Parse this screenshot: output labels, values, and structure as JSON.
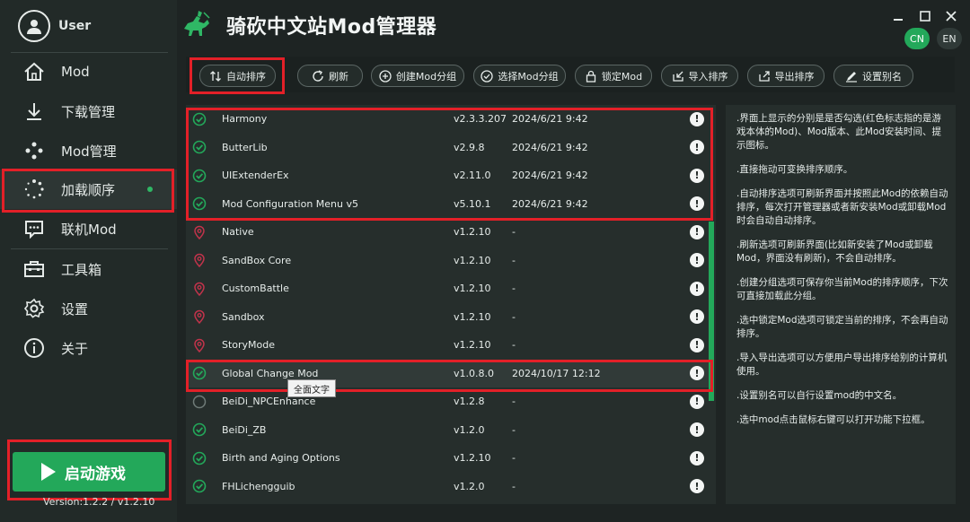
{
  "user": {
    "name": "User"
  },
  "sidebar": {
    "items": [
      {
        "label": "Mod",
        "icon": "home-icon"
      },
      {
        "label": "下载管理",
        "icon": "download-icon"
      },
      {
        "label": "Mod管理",
        "icon": "dots-icon"
      },
      {
        "label": "加载顺序",
        "icon": "loading-icon",
        "active": true
      },
      {
        "label": "联机Mod",
        "icon": "chat-icon"
      },
      {
        "label": "工具箱",
        "icon": "toolbox-icon"
      },
      {
        "label": "设置",
        "icon": "gear-icon"
      },
      {
        "label": "关于",
        "icon": "info-icon"
      }
    ]
  },
  "launch": {
    "label": "启动游戏"
  },
  "version": "Version:1.2.2 / v1.2.10",
  "app": {
    "title": "骑砍中文站Mod管理器"
  },
  "lang": {
    "cn": "CN",
    "en": "EN"
  },
  "toolbar": {
    "auto_sort": "自动排序",
    "refresh": "刷新",
    "create_group": "创建Mod分组",
    "select_group": "选择Mod分组",
    "lock_mod": "锁定Mod",
    "import_sort": "导入排序",
    "export_sort": "导出排序",
    "set_alias": "设置别名"
  },
  "mods": [
    {
      "name": "Harmony",
      "version": "v2.3.3.207",
      "date": "2024/6/21 9:42",
      "status": "enabled"
    },
    {
      "name": "ButterLib",
      "version": "v2.9.8",
      "date": "2024/6/21 9:42",
      "status": "enabled"
    },
    {
      "name": "UIExtenderEx",
      "version": "v2.11.0",
      "date": "2024/6/21 9:42",
      "status": "enabled"
    },
    {
      "name": "Mod Configuration Menu v5",
      "version": "v5.10.1",
      "date": "2024/6/21 9:42",
      "status": "enabled"
    },
    {
      "name": "Native",
      "version": "v1.2.10",
      "date": "-",
      "status": "official"
    },
    {
      "name": "SandBox Core",
      "version": "v1.2.10",
      "date": "-",
      "status": "official"
    },
    {
      "name": "CustomBattle",
      "version": "v1.2.10",
      "date": "-",
      "status": "official"
    },
    {
      "name": "Sandbox",
      "version": "v1.2.10",
      "date": "-",
      "status": "official"
    },
    {
      "name": "StoryMode",
      "version": "v1.2.10",
      "date": "-",
      "status": "official"
    },
    {
      "name": "Global Change Mod",
      "version": "v1.0.8.0",
      "date": "2024/10/17 12:12",
      "status": "enabled"
    },
    {
      "name": "BeiDi_NPCEnhance",
      "version": "v1.2.8",
      "date": "-",
      "status": "disabled"
    },
    {
      "name": "BeiDi_ZB",
      "version": "v1.2.0",
      "date": "-",
      "status": "enabled"
    },
    {
      "name": "Birth and Aging Options",
      "version": "v1.2.10",
      "date": "-",
      "status": "enabled"
    },
    {
      "name": "FHLichengguib",
      "version": "v1.2.0",
      "date": "-",
      "status": "enabled"
    }
  ],
  "tooltip": "全面文字",
  "help": [
    ".界面上显示的分别是是否勾选(红色标志指的是游戏本体的Mod)、Mod版本、此Mod安装时间、提示图标。",
    ".直接拖动可变换排序顺序。",
    ".自动排序选项可刷新界面并按照此Mod的依赖自动排序，每次打开管理器或者新安装Mod或卸载Mod时会自动自动排序。",
    ".刷新选项可刷新界面(比如新安装了Mod或卸载Mod，界面没有刷新)，不会自动排序。",
    ".创建分组选项可保存你当前Mod的排序顺序，下次可直接加载此分组。",
    ".选中锁定Mod选项可锁定当前的排序，不会再自动排序。",
    ".导入导出选项可以方便用户导出排序给别的计算机使用。",
    ".设置别名可以自行设置mod的中文名。",
    ".选中mod点击鼠标右键可以打开功能下拉框。"
  ],
  "colors": {
    "accent": "#23a85a",
    "highlight": "#e32028",
    "official": "#c2334b"
  }
}
